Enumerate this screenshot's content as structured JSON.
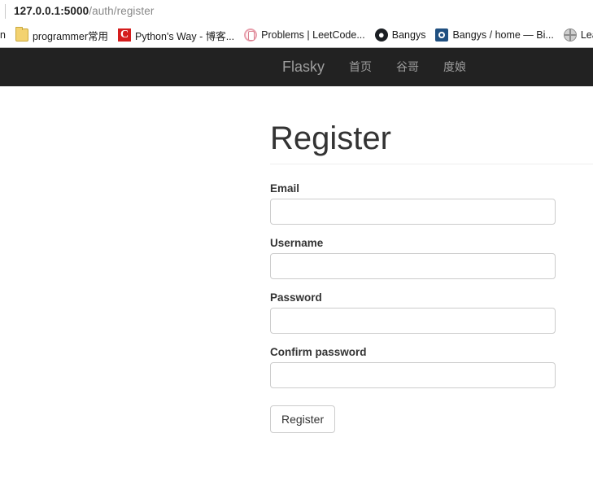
{
  "browser": {
    "url": {
      "host": "127.0.0.1:5000",
      "path": "/auth/register",
      "full": "127.0.0.1:5000/auth/register"
    },
    "bookmarks": [
      {
        "label": "n",
        "icon": "",
        "partial": true
      },
      {
        "label": "programmer常用",
        "icon": "folder-icon"
      },
      {
        "label": "Python's Way - 博客...",
        "icon": "cnblogs-icon"
      },
      {
        "label": "Problems | LeetCode...",
        "icon": "leetcode-icon"
      },
      {
        "label": "Bangys",
        "icon": "github-icon"
      },
      {
        "label": "Bangys / home — Bi...",
        "icon": "bitbucket-icon"
      },
      {
        "label": "Learn",
        "icon": "globe-icon"
      }
    ]
  },
  "navbar": {
    "brand": "Flasky",
    "links": [
      {
        "label": "首页"
      },
      {
        "label": "谷哥"
      },
      {
        "label": "度娘"
      }
    ],
    "background": "#222222",
    "link_color": "#9d9d9d"
  },
  "page": {
    "title": "Register"
  },
  "form": {
    "fields": [
      {
        "label": "Email",
        "value": "",
        "placeholder": "",
        "type": "text",
        "name": "email-field"
      },
      {
        "label": "Username",
        "value": "",
        "placeholder": "",
        "type": "text",
        "name": "username-field"
      },
      {
        "label": "Password",
        "value": "",
        "placeholder": "",
        "type": "password",
        "name": "password-field"
      },
      {
        "label": "Confirm password",
        "value": "",
        "placeholder": "",
        "type": "password",
        "name": "confirm-password-field"
      }
    ],
    "submit_label": "Register"
  }
}
